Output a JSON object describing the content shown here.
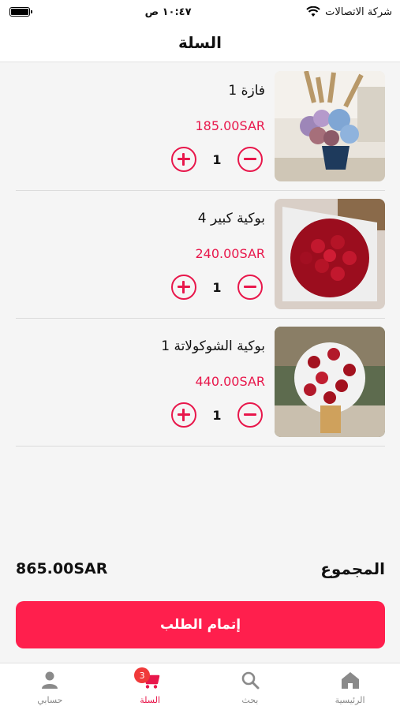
{
  "status_bar": {
    "carrier": "شركة الاتصالات",
    "time": "١٠:٤٧ ص"
  },
  "header": {
    "title": "السلة"
  },
  "cart": {
    "items": [
      {
        "name": "فازة 1",
        "price": "185.00SAR",
        "quantity": "1",
        "image_icon": "vase-flowers-image"
      },
      {
        "name": "بوكية كبير 4",
        "price": "240.00SAR",
        "quantity": "1",
        "image_icon": "red-rose-bouquet-image"
      },
      {
        "name": "بوكية الشوكولاتة 1",
        "price": "440.00SAR",
        "quantity": "1",
        "image_icon": "chocolate-bouquet-image"
      }
    ]
  },
  "summary": {
    "total_label": "المجموع",
    "total_amount": "865.00SAR",
    "checkout_label": "إتمام الطلب"
  },
  "bottom_nav": {
    "items": [
      {
        "label": "حسابي",
        "icon": "user-icon"
      },
      {
        "label": "السلة",
        "icon": "cart-icon",
        "badge": "3",
        "active": true
      },
      {
        "label": "بحث",
        "icon": "search-icon"
      },
      {
        "label": "الرئيسية",
        "icon": "home-icon"
      }
    ]
  },
  "colors": {
    "accent": "#e8174b",
    "button": "#ff1f4d",
    "badge": "#f03a3a"
  }
}
